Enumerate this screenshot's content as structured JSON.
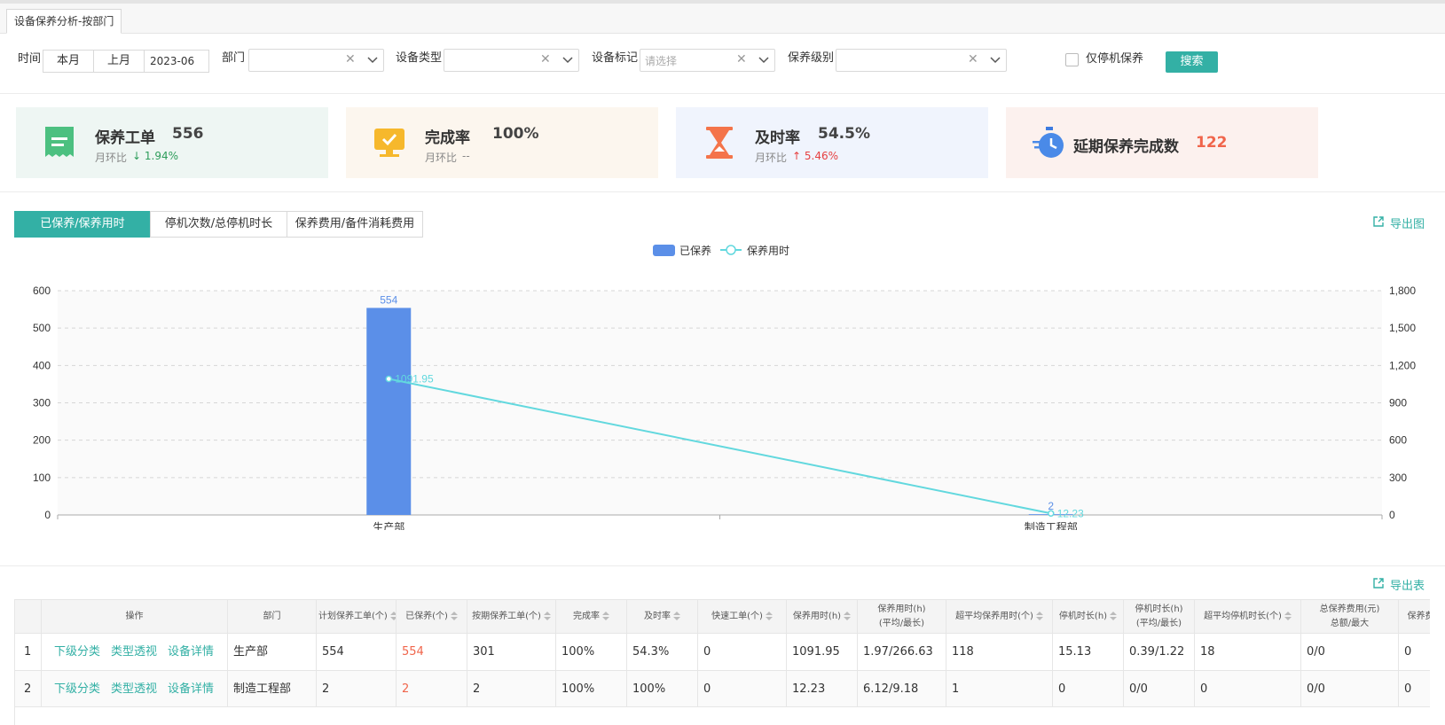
{
  "page_tab": "设备保养分析-按部门",
  "filters": {
    "time_label": "时间",
    "this_month": "本月",
    "last_month": "上月",
    "month_value": "2023-06",
    "dept_label": "部门",
    "equip_type_label": "设备类型",
    "equip_mark_label": "设备标记",
    "equip_mark_placeholder": "请选择",
    "level_label": "保养级别",
    "stop_only_label": "仅停机保养",
    "search_button": "搜索"
  },
  "cards": [
    {
      "title": "保养工单",
      "value": "556",
      "mom_label": "月环比",
      "delta": "1.94%",
      "delta_dir": "down",
      "bg": "#eef6f3",
      "icon": "receipt-icon"
    },
    {
      "title": "完成率",
      "value": "100%",
      "mom_label": "月环比",
      "delta": "--",
      "delta_dir": "none",
      "bg": "#fcf6ee",
      "icon": "monitor-check-icon"
    },
    {
      "title": "及时率",
      "value": "54.5%",
      "mom_label": "月环比",
      "delta": "5.46%",
      "delta_dir": "up",
      "bg": "#f0f4fd",
      "icon": "hourglass-icon"
    },
    {
      "title": "延期保养完成数",
      "value": "122",
      "bg": "#fcf1ee",
      "icon": "stopwatch-icon"
    }
  ],
  "chart_tabs": [
    "已保养/保养用时",
    "停机次数/总停机时长",
    "保养费用/备件消耗费用"
  ],
  "export_chart": "导出图",
  "export_table": "导出表",
  "colors": {
    "accent": "#33b0a5",
    "bar": "#5b8fe8",
    "line": "#62d8de",
    "red": "#f0654b",
    "green": "#2e9d5b"
  },
  "chart_data": {
    "type": "bar",
    "categories": [
      "生产部",
      "制造工程部"
    ],
    "series": [
      {
        "name": "已保养",
        "type": "bar",
        "axis": "left",
        "values": [
          554,
          2
        ]
      },
      {
        "name": "保养用时",
        "type": "line",
        "axis": "right",
        "values": [
          1091.95,
          12.23
        ]
      }
    ],
    "y_left": {
      "ticks": [
        "0",
        "100",
        "200",
        "300",
        "400",
        "500",
        "600"
      ],
      "min": 0,
      "max": 600
    },
    "y_right": {
      "ticks": [
        "0",
        "300",
        "600",
        "900",
        "1,200",
        "1,500",
        "1,800"
      ],
      "min": 0,
      "max": 1800
    },
    "legend_position": "top-center",
    "grid": true
  },
  "table": {
    "headers": [
      {
        "l1": ""
      },
      {
        "l1": "操作"
      },
      {
        "l1": "部门"
      },
      {
        "l1": "计划保养工单(个)",
        "sort": true
      },
      {
        "l1": "已保养(个)",
        "sort": true
      },
      {
        "l1": "按期保养工单(个)",
        "sort": true
      },
      {
        "l1": "完成率",
        "sort": true
      },
      {
        "l1": "及时率",
        "sort": true
      },
      {
        "l1": "快速工单(个)",
        "sort": true
      },
      {
        "l1": "保养用时(h)",
        "sort": true
      },
      {
        "l1": "保养用时(h)",
        "l2": "(平均/最长)"
      },
      {
        "l1": "超平均保养用时(个)",
        "sort": true
      },
      {
        "l1": "停机时长(h)",
        "sort": true
      },
      {
        "l1": "停机时长(h)",
        "l2": "(平均/最长)"
      },
      {
        "l1": "超平均停机时长(个)",
        "sort": true
      },
      {
        "l1": "总保养费用(元)",
        "l2": "总额/最大"
      },
      {
        "l1": "保养费用"
      }
    ],
    "op_links": [
      "下级分类",
      "类型透视",
      "设备详情"
    ],
    "rows": [
      {
        "idx": "1",
        "dept": "生产部",
        "plan": "554",
        "done": "554",
        "ontime_cnt": "301",
        "rate": "100%",
        "timely": "54.3%",
        "quick": "0",
        "hours": "1091.95",
        "hours_avg_max": "1.97/266.63",
        "over_avg": "118",
        "stop": "15.13",
        "stop_avg_max": "0.39/1.22",
        "over_stop": "18",
        "cost": "0/0",
        "cost2": "0"
      },
      {
        "idx": "2",
        "dept": "制造工程部",
        "plan": "2",
        "done": "2",
        "ontime_cnt": "2",
        "rate": "100%",
        "timely": "100%",
        "quick": "0",
        "hours": "12.23",
        "hours_avg_max": "6.12/9.18",
        "over_avg": "1",
        "stop": "0",
        "stop_avg_max": "0/0",
        "over_stop": "0",
        "cost": "0/0",
        "cost2": "0"
      }
    ]
  }
}
